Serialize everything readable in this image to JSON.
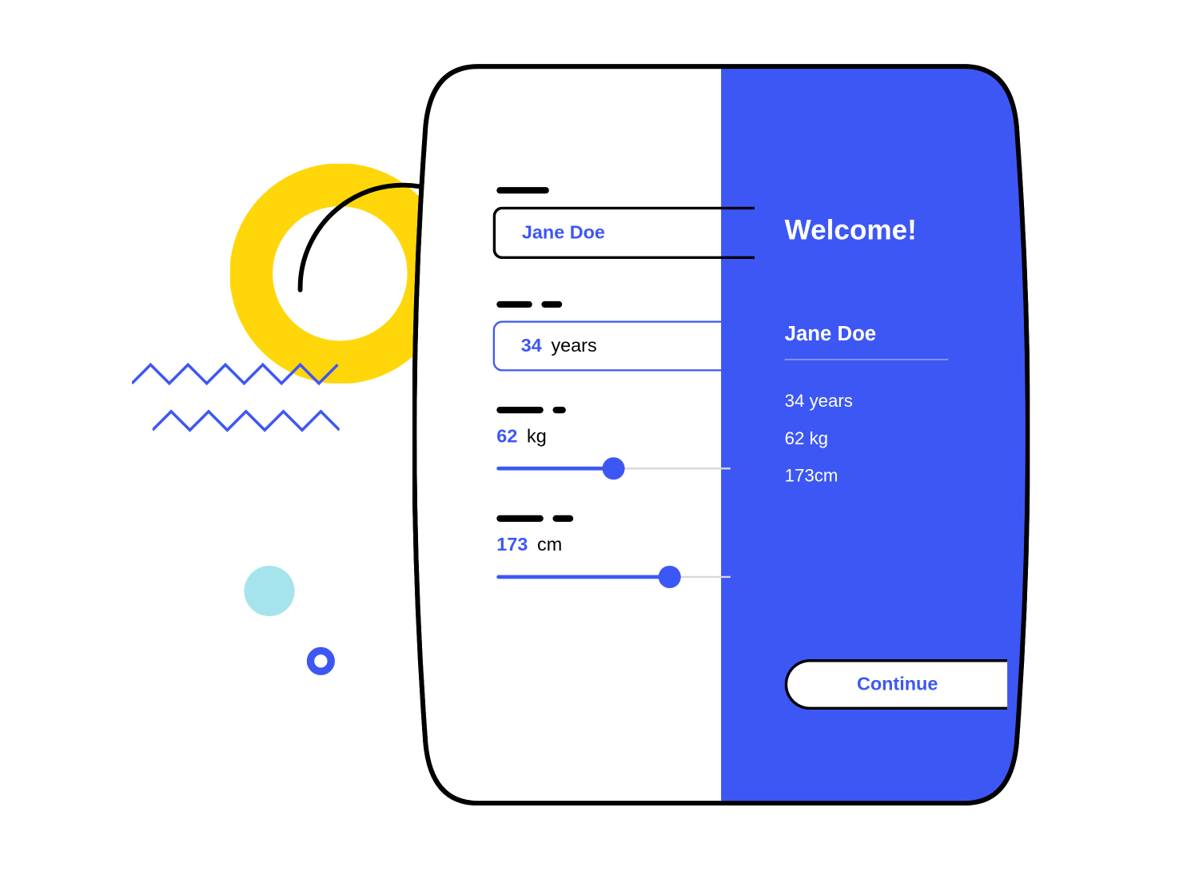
{
  "form": {
    "name": "Jane Doe",
    "age": {
      "value": "34",
      "unit": "years"
    },
    "weight": {
      "value": "62",
      "unit": "kg",
      "slider_percent": 50
    },
    "height": {
      "value": "173",
      "unit": "cm",
      "slider_percent": 74
    }
  },
  "summary": {
    "welcome": "Welcome!",
    "name": "Jane Doe",
    "age_line": "34 years",
    "weight_line": "62 kg",
    "height_line": "173cm"
  },
  "actions": {
    "continue": "Continue"
  },
  "colors": {
    "accent": "#3d57f4",
    "yellow": "#ffd60a",
    "cyan": "#a6e4ed"
  }
}
